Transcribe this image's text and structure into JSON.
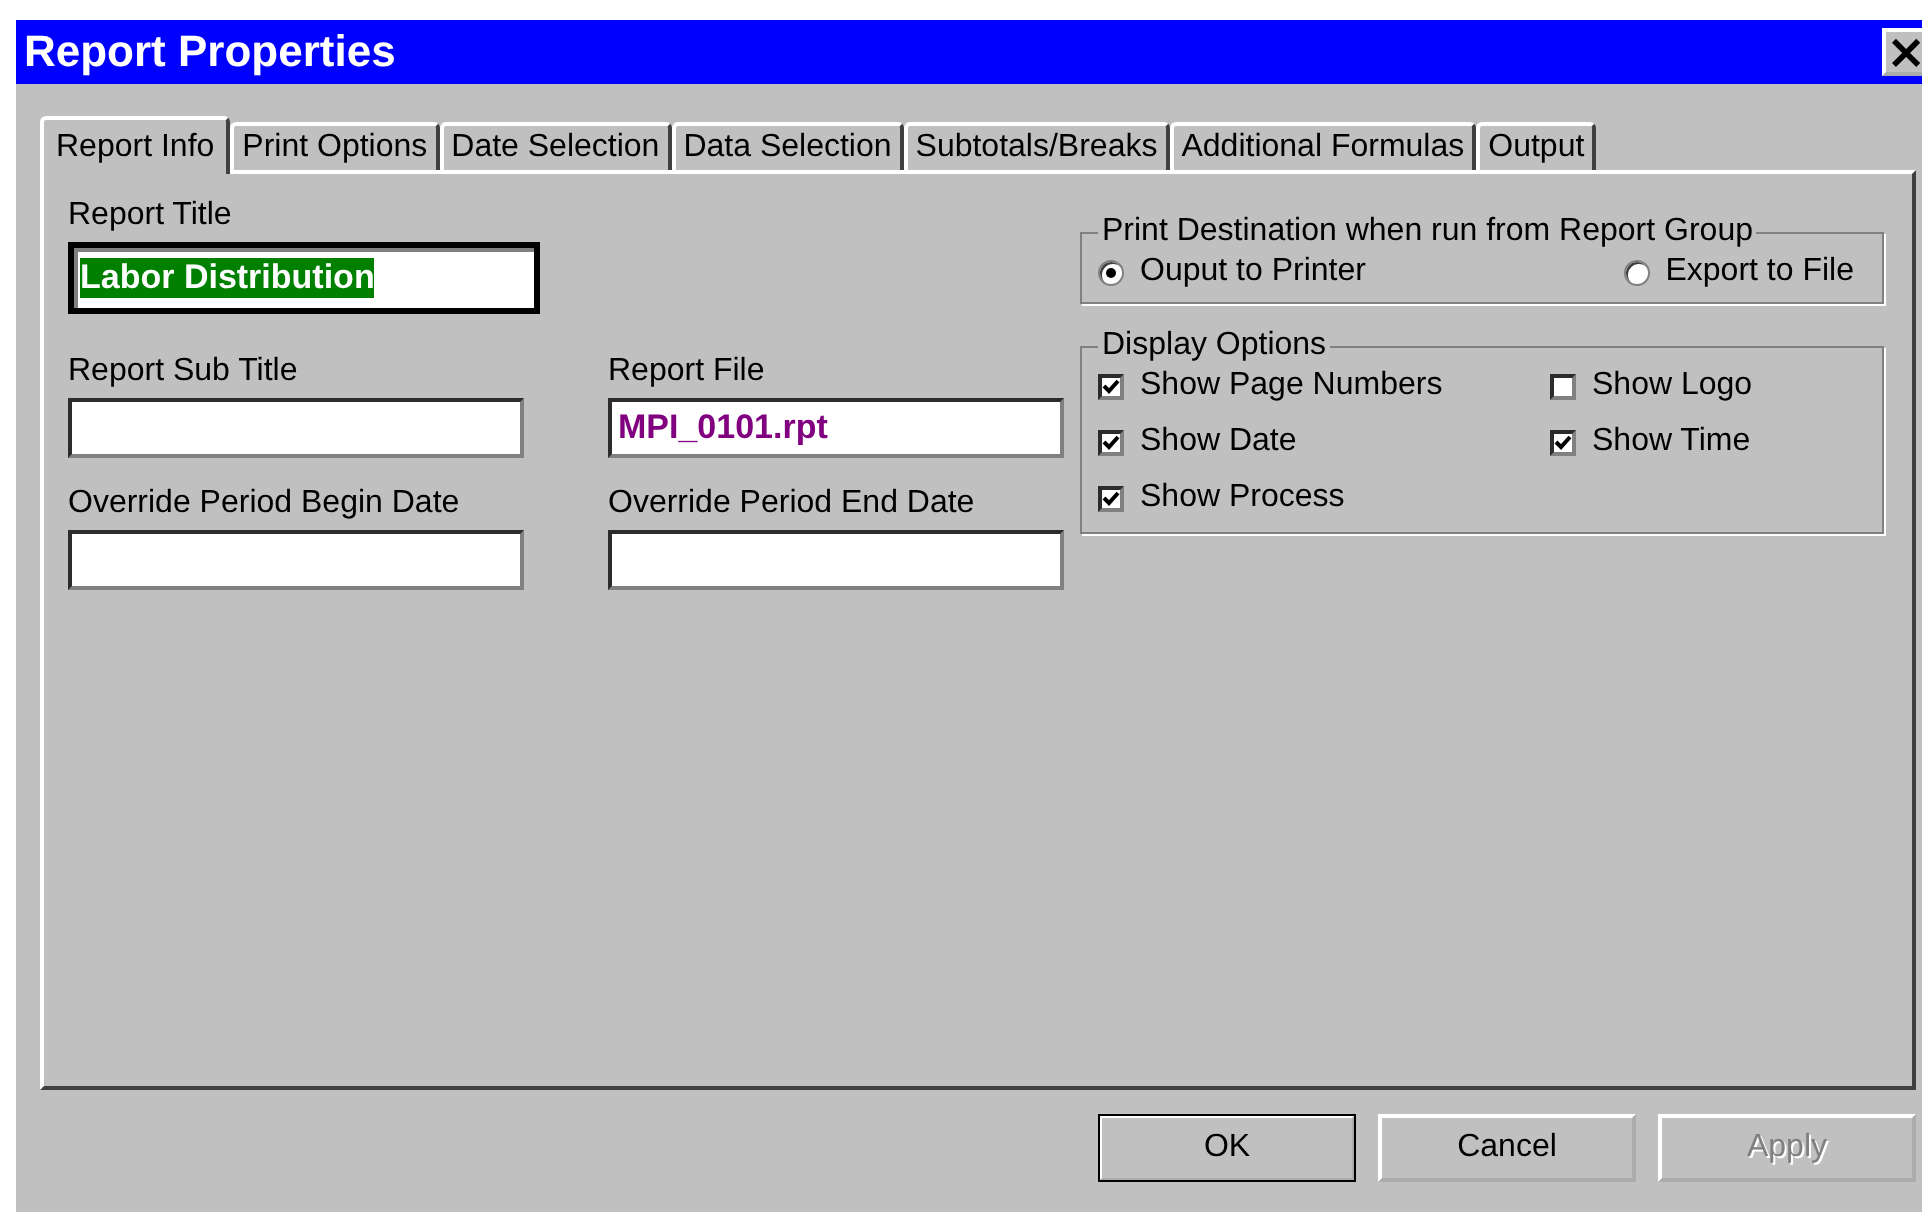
{
  "window": {
    "title": "Report Properties",
    "close_glyph": "×"
  },
  "tabs": [
    {
      "label": "Report Info",
      "selected": true
    },
    {
      "label": "Print Options",
      "selected": false
    },
    {
      "label": "Date Selection",
      "selected": false
    },
    {
      "label": "Data Selection",
      "selected": false
    },
    {
      "label": "Subtotals/Breaks",
      "selected": false
    },
    {
      "label": "Additional Formulas",
      "selected": false
    },
    {
      "label": "Output",
      "selected": false
    }
  ],
  "report_title": {
    "label": "Report Title",
    "value": "Labor Distribution",
    "text_selected": true
  },
  "fields": [
    {
      "label": "Report Sub Title"
    },
    {
      "label": "Report File",
      "value": "MPI_0101.rpt"
    },
    {
      "label": "Override Period Begin Date"
    },
    {
      "label": "Override Period End Date"
    }
  ],
  "print_destination": {
    "title": "Print Destination when run from Report Group",
    "options": [
      {
        "label": "Ouput to Printer",
        "selected": true
      },
      {
        "label": "Export to File",
        "selected": false
      }
    ]
  },
  "display_options": {
    "title": "Display Options",
    "options": [
      {
        "label": "Show Page Numbers",
        "checked": true
      },
      {
        "label": "Show Logo",
        "checked": false
      },
      {
        "label": "Show Date",
        "checked": true
      },
      {
        "label": "Show Time",
        "checked": true
      },
      {
        "label": "Show Process",
        "checked": true
      }
    ]
  },
  "buttons": [
    {
      "label": "OK",
      "default": true,
      "disabled": false
    },
    {
      "label": "Cancel",
      "default": false,
      "disabled": false
    },
    {
      "label": "Apply",
      "default": false,
      "disabled": true
    }
  ]
}
